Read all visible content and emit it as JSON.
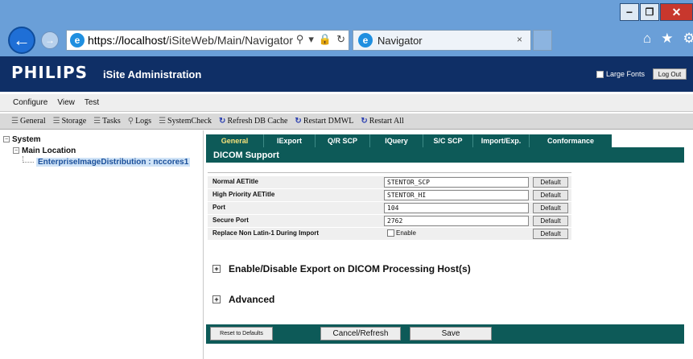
{
  "browser": {
    "url_host": "https://localhost",
    "url_path": "/iSiteWeb/Main/Navigator",
    "tab_title": "Navigator",
    "tab_close": "×",
    "addr_icons": [
      "⚲",
      "▾",
      "🔒",
      "↻"
    ]
  },
  "header": {
    "logo": "PHILIPS",
    "app_title": "iSite Administration",
    "large_fonts_label": "Large Fonts",
    "logout_label": "Log Out"
  },
  "menu": [
    "Configure",
    "View",
    "Test"
  ],
  "toolbar": [
    {
      "icon": "list-icon",
      "label": "General"
    },
    {
      "icon": "list-icon",
      "label": "Storage"
    },
    {
      "icon": "list-icon",
      "label": "Tasks"
    },
    {
      "icon": "logs-icon",
      "label": "Logs"
    },
    {
      "icon": "list-icon",
      "label": "SystemCheck"
    },
    {
      "icon": "refresh-icon",
      "label": "Refresh DB Cache"
    },
    {
      "icon": "refresh-icon",
      "label": "Restart DMWL"
    },
    {
      "icon": "refresh-icon",
      "label": "Restart All"
    }
  ],
  "tree": {
    "root": "System",
    "child": "Main Location",
    "selected": "EnterpriseImageDistribution : nccores1"
  },
  "tabs": [
    "General",
    "IExport",
    "Q/R SCP",
    "IQuery",
    "S/C SCP",
    "Import/Exp.",
    "Conformance"
  ],
  "active_tab": "General",
  "section_title": "DICOM Support",
  "form": {
    "rows": [
      {
        "label": "Normal AETitle",
        "value": "STENTOR_SCP",
        "default": "Default"
      },
      {
        "label": "High Priority AETitle",
        "value": "STENTOR_HI",
        "default": "Default"
      },
      {
        "label": "Port",
        "value": "104",
        "default": "Default"
      },
      {
        "label": "Secure Port",
        "value": "2762",
        "default": "Default"
      }
    ],
    "checkbox_row": {
      "label": "Replace Non Latin-1 During Import",
      "checkbox_label": "Enable",
      "checked": false,
      "default": "Default"
    }
  },
  "sections": {
    "export_host": "Enable/Disable Export on DICOM Processing Host(s)",
    "advanced": "Advanced",
    "expand_symbol": "+"
  },
  "footer": {
    "reset": "Reset to Defaults",
    "cancel": "Cancel/Refresh",
    "save": "Save"
  },
  "colors": {
    "browser_chrome": "#6a9fd8",
    "header_navy": "#0f2f66",
    "panel_teal": "#0d5a58",
    "active_tab_text": "#f7e27a"
  }
}
